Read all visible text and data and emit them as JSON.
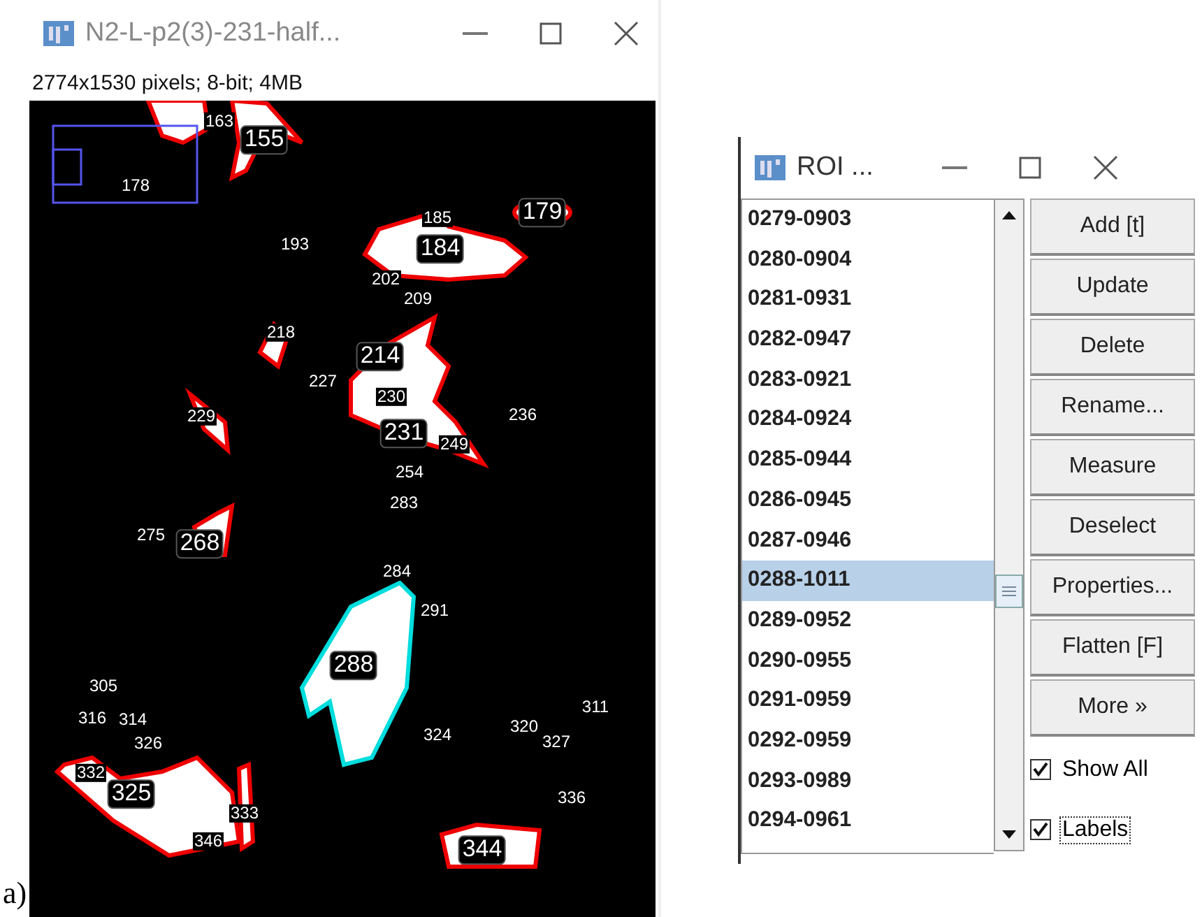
{
  "panel_label": "a)",
  "image_window": {
    "title": "N2-L-p2(3)-231-half...",
    "info": "2774x1530 pixels; 8-bit; 4MB",
    "roi_labels": [
      {
        "text": "163",
        "kind": "plain"
      },
      {
        "text": "155",
        "kind": "boxed"
      },
      {
        "text": "178",
        "kind": "plain"
      },
      {
        "text": "193",
        "kind": "plain"
      },
      {
        "text": "185",
        "kind": "plain"
      },
      {
        "text": "184",
        "kind": "boxed"
      },
      {
        "text": "179",
        "kind": "boxed"
      },
      {
        "text": "202",
        "kind": "plain"
      },
      {
        "text": "209",
        "kind": "plain"
      },
      {
        "text": "218",
        "kind": "plain"
      },
      {
        "text": "227",
        "kind": "plain"
      },
      {
        "text": "214",
        "kind": "boxed"
      },
      {
        "text": "230",
        "kind": "plain"
      },
      {
        "text": "229",
        "kind": "plain"
      },
      {
        "text": "236",
        "kind": "plain"
      },
      {
        "text": "231",
        "kind": "boxed"
      },
      {
        "text": "249",
        "kind": "plain"
      },
      {
        "text": "254",
        "kind": "plain"
      },
      {
        "text": "283",
        "kind": "plain"
      },
      {
        "text": "275",
        "kind": "plain"
      },
      {
        "text": "268",
        "kind": "boxed"
      },
      {
        "text": "284",
        "kind": "plain"
      },
      {
        "text": "291",
        "kind": "plain"
      },
      {
        "text": "288",
        "kind": "boxed"
      },
      {
        "text": "305",
        "kind": "plain"
      },
      {
        "text": "316",
        "kind": "plain"
      },
      {
        "text": "314",
        "kind": "plain"
      },
      {
        "text": "326",
        "kind": "plain"
      },
      {
        "text": "311",
        "kind": "plain"
      },
      {
        "text": "324",
        "kind": "plain"
      },
      {
        "text": "320",
        "kind": "plain"
      },
      {
        "text": "327",
        "kind": "plain"
      },
      {
        "text": "332",
        "kind": "plain"
      },
      {
        "text": "325",
        "kind": "boxed"
      },
      {
        "text": "333",
        "kind": "plain"
      },
      {
        "text": "336",
        "kind": "plain"
      },
      {
        "text": "346",
        "kind": "plain"
      },
      {
        "text": "344",
        "kind": "boxed"
      }
    ]
  },
  "roi_manager": {
    "title": "ROI ...",
    "rois": [
      {
        "name": "0279-0903",
        "selected": false
      },
      {
        "name": "0280-0904",
        "selected": false
      },
      {
        "name": "0281-0931",
        "selected": false
      },
      {
        "name": "0282-0947",
        "selected": false
      },
      {
        "name": "0283-0921",
        "selected": false
      },
      {
        "name": "0284-0924",
        "selected": false
      },
      {
        "name": "0285-0944",
        "selected": false
      },
      {
        "name": "0286-0945",
        "selected": false
      },
      {
        "name": "0287-0946",
        "selected": false
      },
      {
        "name": "0288-1011",
        "selected": true
      },
      {
        "name": "0289-0952",
        "selected": false
      },
      {
        "name": "0290-0955",
        "selected": false
      },
      {
        "name": "0291-0959",
        "selected": false
      },
      {
        "name": "0292-0959",
        "selected": false
      },
      {
        "name": "0293-0989",
        "selected": false
      },
      {
        "name": "0294-0961",
        "selected": false
      }
    ],
    "buttons": [
      "Add [t]",
      "Update",
      "Delete",
      "Rename...",
      "Measure",
      "Deselect",
      "Properties...",
      "Flatten [F]",
      "More »"
    ],
    "options": [
      {
        "label": "Show All",
        "checked": true,
        "focused": false
      },
      {
        "label": "Labels",
        "checked": true,
        "focused": true
      }
    ]
  }
}
